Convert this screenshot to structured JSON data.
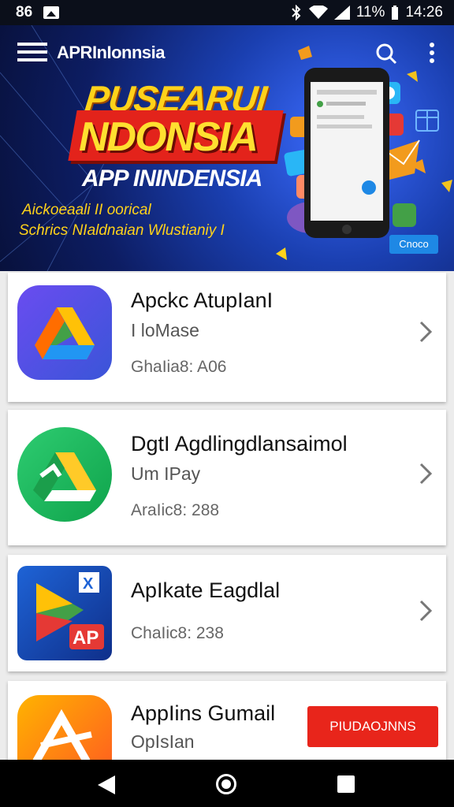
{
  "status_bar": {
    "left_text": "86",
    "battery": "11%",
    "time": "14:26"
  },
  "header": {
    "app_name": "APRInIonnsia"
  },
  "banner": {
    "headline1": "PUSEARUI",
    "headline2": "NDONSIA",
    "headline3": "APP ININDENSIA",
    "tagline1": "Aickoeaali II oorical",
    "tagline2": "Schrics NIaldnaian Wlustianiy I",
    "button_label": "Cnoco"
  },
  "apps": [
    {
      "title": "Apckc AtupIanI",
      "subtitle": "I loMase",
      "meta": "GhaIia8: A06"
    },
    {
      "title": "DgtI Agdlingdlansaimol",
      "subtitle": "Um IPay",
      "meta": "AraIic8: 288"
    },
    {
      "title": "ApIkate Eagdlal",
      "subtitle": "",
      "meta": "ChaIic8: 238"
    },
    {
      "title": "AppIins Gumail",
      "subtitle": "OpIsIan",
      "meta": "",
      "button_label": "PIUDAOJNNS"
    }
  ],
  "app4_badge": "AP",
  "colors": {
    "banner_bg": "#1a3fb0",
    "accent_red": "#e8251b",
    "headline_yellow": "#ffd21a"
  }
}
